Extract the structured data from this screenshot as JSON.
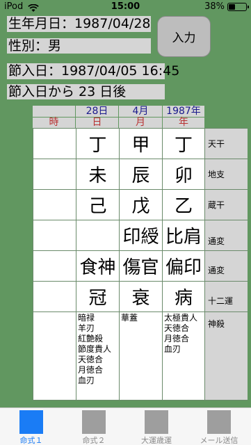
{
  "status": {
    "carrier": "iPod",
    "time": "15:00",
    "battery": "38%"
  },
  "info": {
    "birth": "生年月日：1987/04/28",
    "gender": "性別：男",
    "setsu": "節入日：1987/04/05 16:45",
    "after": "節入日から 23 日後"
  },
  "input_button": "入力",
  "columns": {
    "dates": [
      "",
      "28日",
      "4月",
      "1987年"
    ],
    "pillars": [
      "時",
      "日",
      "月",
      "年"
    ]
  },
  "rows": {
    "tenkan": [
      "",
      "丁",
      "甲",
      "丁"
    ],
    "chishi": [
      "",
      "未",
      "辰",
      "卯"
    ],
    "zouka": [
      "",
      "己",
      "戊",
      "乙"
    ],
    "tsuhen1": [
      "",
      "",
      "印綬",
      "比肩"
    ],
    "tsuhen2": [
      "",
      "食神",
      "傷官",
      "偏印"
    ],
    "juniun": [
      "",
      "冠",
      "衰",
      "病"
    ]
  },
  "labels": {
    "tenkan": "天干",
    "chishi": "地支",
    "zouka": "蔵干",
    "tsuhen1": "通変",
    "tsuhen2": "通変",
    "juniun": "十二運",
    "shinsatsu": "神殺"
  },
  "shinsatsu": {
    "day": "暗禄\n羊刃\n紅艶殺\n節度貴人\n天徳合\n月徳合\n血刃",
    "month": "華蓋",
    "year": "太極貴人\n天徳合\n月徳合\n血刃"
  },
  "tabs": [
    {
      "label": "命式１",
      "active": true
    },
    {
      "label": "命式２",
      "active": false
    },
    {
      "label": "大運歳運",
      "active": false
    },
    {
      "label": "メール送信",
      "active": false
    }
  ],
  "colors": {
    "background": "#619760",
    "accent": "#1a7cf5",
    "header_text": "#1a1a8c",
    "pillar_text": "#b83232"
  }
}
